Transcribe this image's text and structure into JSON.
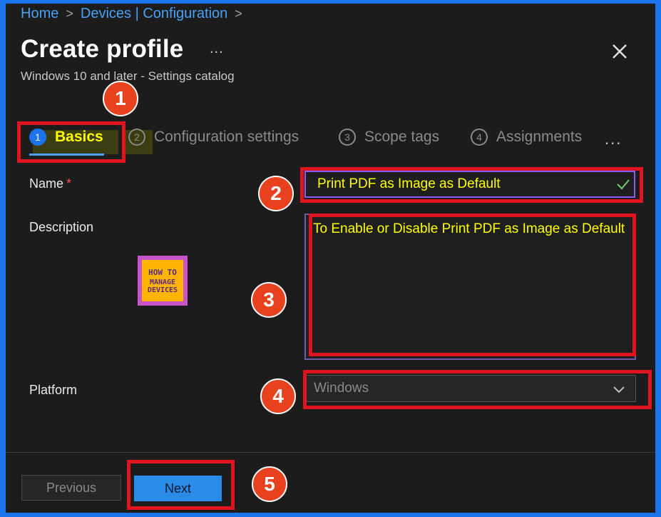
{
  "breadcrumb": {
    "items": [
      {
        "label": "Home"
      },
      {
        "label": "Devices | Configuration"
      }
    ],
    "separator": ">"
  },
  "header": {
    "title": "Create profile",
    "more": "...",
    "subtitle": "Windows 10 and later - Settings catalog",
    "close_icon": "close-icon"
  },
  "tabs": [
    {
      "num": "1",
      "label": "Basics",
      "active": true
    },
    {
      "num": "2",
      "label": "Configuration settings",
      "active": false
    },
    {
      "num": "3",
      "label": "Scope tags",
      "active": false
    },
    {
      "num": "4",
      "label": "Assignments",
      "active": false
    }
  ],
  "tabs_more": "...",
  "form": {
    "name_label": "Name",
    "required_mark": "*",
    "name_value": "Print PDF as Image as Default",
    "description_label": "Description",
    "description_value": "To Enable or Disable Print PDF as Image as Default",
    "platform_label": "Platform",
    "platform_value": "Windows"
  },
  "logo": {
    "line1": "HOW TO",
    "line2": "MANAGE DEVICES"
  },
  "annotations": [
    "1",
    "2",
    "3",
    "4",
    "5"
  ],
  "footer": {
    "previous_label": "Previous",
    "next_label": "Next"
  },
  "colors": {
    "accent": "#1a73e8",
    "highlight_text": "#ffff00",
    "annotation_red": "#e0141e",
    "badge_orange": "#e8411e"
  }
}
